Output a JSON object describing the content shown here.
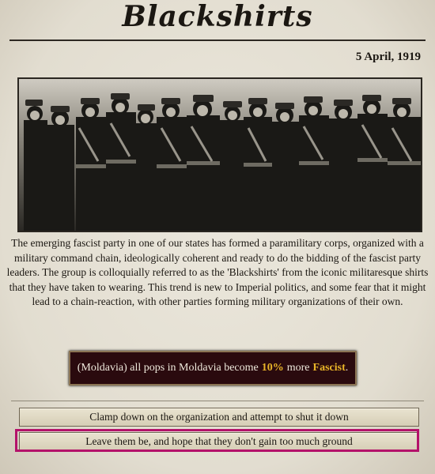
{
  "event": {
    "title": "Blackshirts",
    "date": "5 April, 1919",
    "description": "The emerging fascist party in one of our states has formed a paramilitary corps, organized with a military command chain, ideologically coherent and ready to do the bidding of the fascist party leaders. The group is colloquially referred to as the 'Blackshirts' from the iconic militaresque shirts that they have taken to wearing. This trend is new to Imperial politics, and some fear that it might lead to a chain-reaction, with other parties forming military organizations of their own.",
    "effect": {
      "prefix": "(Moldavia) all pops in Moldavia become",
      "percent": "10%",
      "middle": "more",
      "ideology": "Fascist",
      "suffix": "."
    },
    "options": [
      {
        "label": "Clamp down on the organization and attempt to shut it down"
      },
      {
        "label": "Leave them be, and hope that they don't gain too much ground",
        "selected": true
      }
    ]
  },
  "colors": {
    "background": "#e6e2d6",
    "effect_bg": "#2a0a0e",
    "highlight": "#e8b428",
    "selection": "#b4126a"
  }
}
